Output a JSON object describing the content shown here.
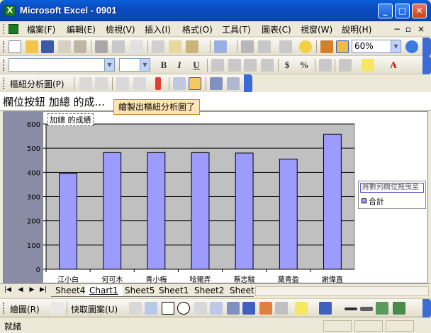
{
  "window": {
    "title": "Microsoft Excel - 0901"
  },
  "menu": {
    "items": [
      "檔案(F)",
      "編輯(E)",
      "檢視(V)",
      "插入(I)",
      "格式(O)",
      "工具(T)",
      "圖表(C)",
      "視窗(W)",
      "說明(H)"
    ],
    "mdi_buttons": [
      "−",
      "▫",
      "×"
    ]
  },
  "standard_toolbar": {
    "zoom": "60%"
  },
  "pivot_toolbar": {
    "label": "樞紐分析圖(P)"
  },
  "formula_bar": {
    "name_box": "欄位按鈕 加總 的成..."
  },
  "tooltip": {
    "text": "繪製出樞紐分析圖了"
  },
  "chart_data": {
    "type": "bar",
    "title": "加總 的成績",
    "categories": [
      "江小白",
      "何可木",
      "青小梅",
      "哈爾弄",
      "蔡志駿",
      "葉青盈",
      "謝偉直"
    ],
    "series": [
      {
        "name": "合計",
        "values": [
          396,
          482,
          482,
          482,
          480,
          455,
          558
        ]
      }
    ],
    "ylim": [
      0,
      600
    ],
    "yticks": [
      0,
      100,
      200,
      300,
      400,
      500,
      600
    ],
    "legend_title": "將數列欄位拖曳至",
    "legend_position": "right",
    "bar_color": "#9C9CFF",
    "plot_bg": "#C0C0C0",
    "grid": true
  },
  "sheet_tabs": [
    "Sheet4",
    "Chart1",
    "Sheet5",
    "Sheet1",
    "Sheet2",
    "Sheet"
  ],
  "active_tab": "Chart1",
  "drawing_toolbar": {
    "draw_label": "繪圖(R)",
    "autoshapes_label": "快取圖案(U)"
  },
  "status": {
    "text": "就緒"
  }
}
